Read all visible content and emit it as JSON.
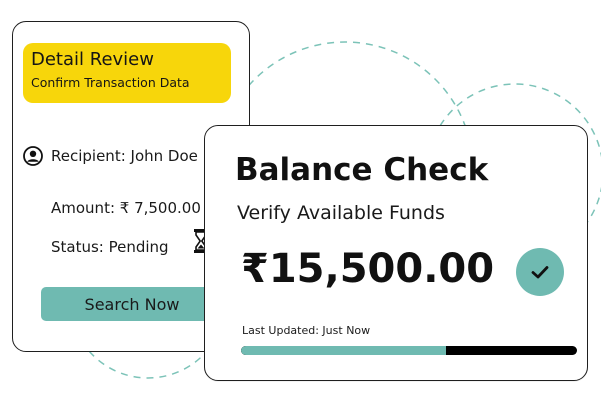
{
  "colors": {
    "accent_yellow": "#f7d60b",
    "teal": "#6fbab1",
    "dash_teal": "#7cc3b8",
    "text_dark": "#111111"
  },
  "detail_card": {
    "title": "Detail Review",
    "subtitle": "Confirm Transaction Data",
    "recipient": "Recipient: John Doe",
    "amount": "Amount: ₹ 7,500.00",
    "status": "Status: Pending",
    "button_label": "Search Now",
    "icons": {
      "recipient": "user-circle-icon",
      "status": "hourglass-icon"
    }
  },
  "balance_card": {
    "title": "Balance Check",
    "subtitle": "Verify Available Funds",
    "amount": "₹15,500.00",
    "last_updated": "Last Updated: Just Now",
    "progress_fraction": 0.61,
    "icons": {
      "confirm": "check-icon"
    }
  }
}
